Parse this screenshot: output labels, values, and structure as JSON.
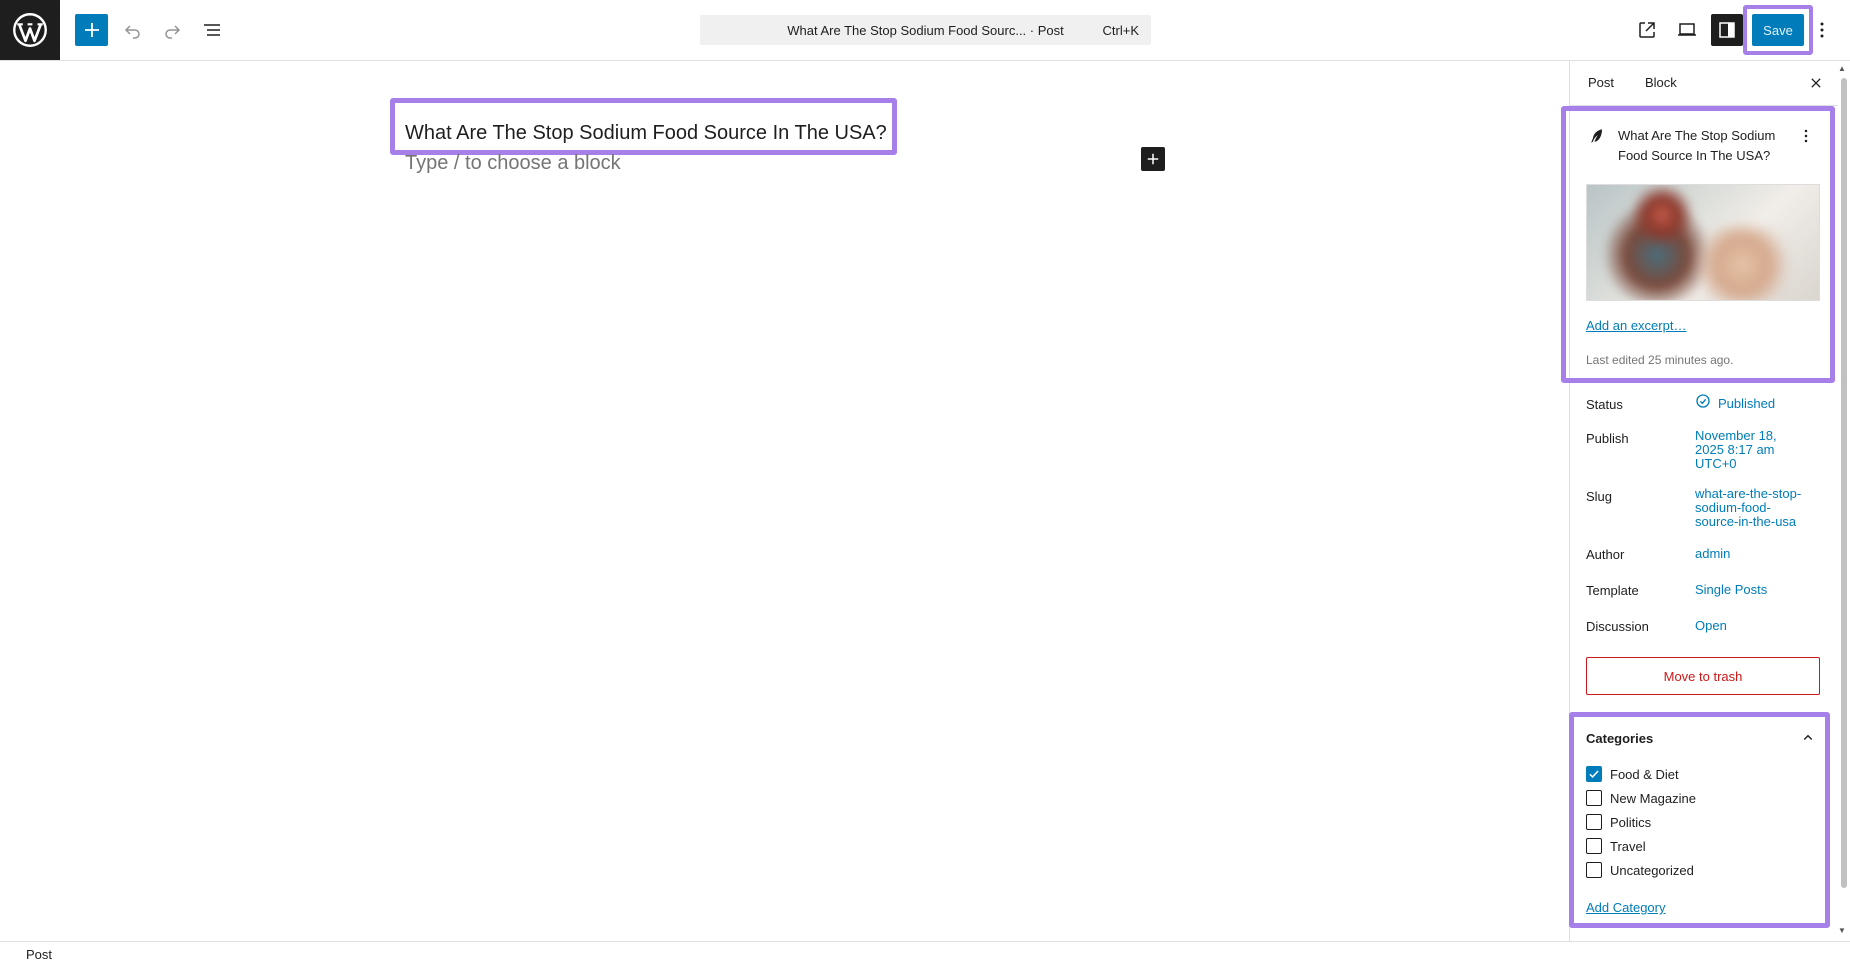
{
  "toolbar": {
    "command_title": "What Are The Stop Sodium Food Sourc... · Post",
    "command_shortcut": "Ctrl+K",
    "save_label": "Save",
    "accent_color": "#007cba"
  },
  "editor": {
    "post_title": "What Are The Stop Sodium Food Source In The USA?",
    "block_placeholder": "Type / to choose a block"
  },
  "sidebar": {
    "tabs": [
      {
        "label": "Post"
      },
      {
        "label": "Block"
      }
    ],
    "summary": {
      "title": "What Are The Stop Sodium Food Source In The USA?",
      "excerpt_link": "Add an excerpt…",
      "last_edited": "Last edited 25 minutes ago."
    },
    "rows": {
      "status": {
        "label": "Status",
        "value": "Published"
      },
      "publish": {
        "label": "Publish",
        "value_lines": [
          "November 18,",
          "2025 8:17 am",
          "UTC+0"
        ]
      },
      "slug": {
        "label": "Slug",
        "value_lines": [
          "what-are-the-stop-",
          "sodium-food-",
          "source-in-the-usa"
        ]
      },
      "author": {
        "label": "Author",
        "value": "admin"
      },
      "template": {
        "label": "Template",
        "value": "Single Posts"
      },
      "discussion": {
        "label": "Discussion",
        "value": "Open"
      }
    },
    "trash_label": "Move to trash",
    "categories": {
      "title": "Categories",
      "items": [
        {
          "label": "Food & Diet",
          "checked": true
        },
        {
          "label": "New Magazine",
          "checked": false
        },
        {
          "label": "Politics",
          "checked": false
        },
        {
          "label": "Travel",
          "checked": false
        },
        {
          "label": "Uncategorized",
          "checked": false
        }
      ],
      "add_label": "Add Category"
    }
  },
  "footer": {
    "breadcrumb": "Post"
  }
}
